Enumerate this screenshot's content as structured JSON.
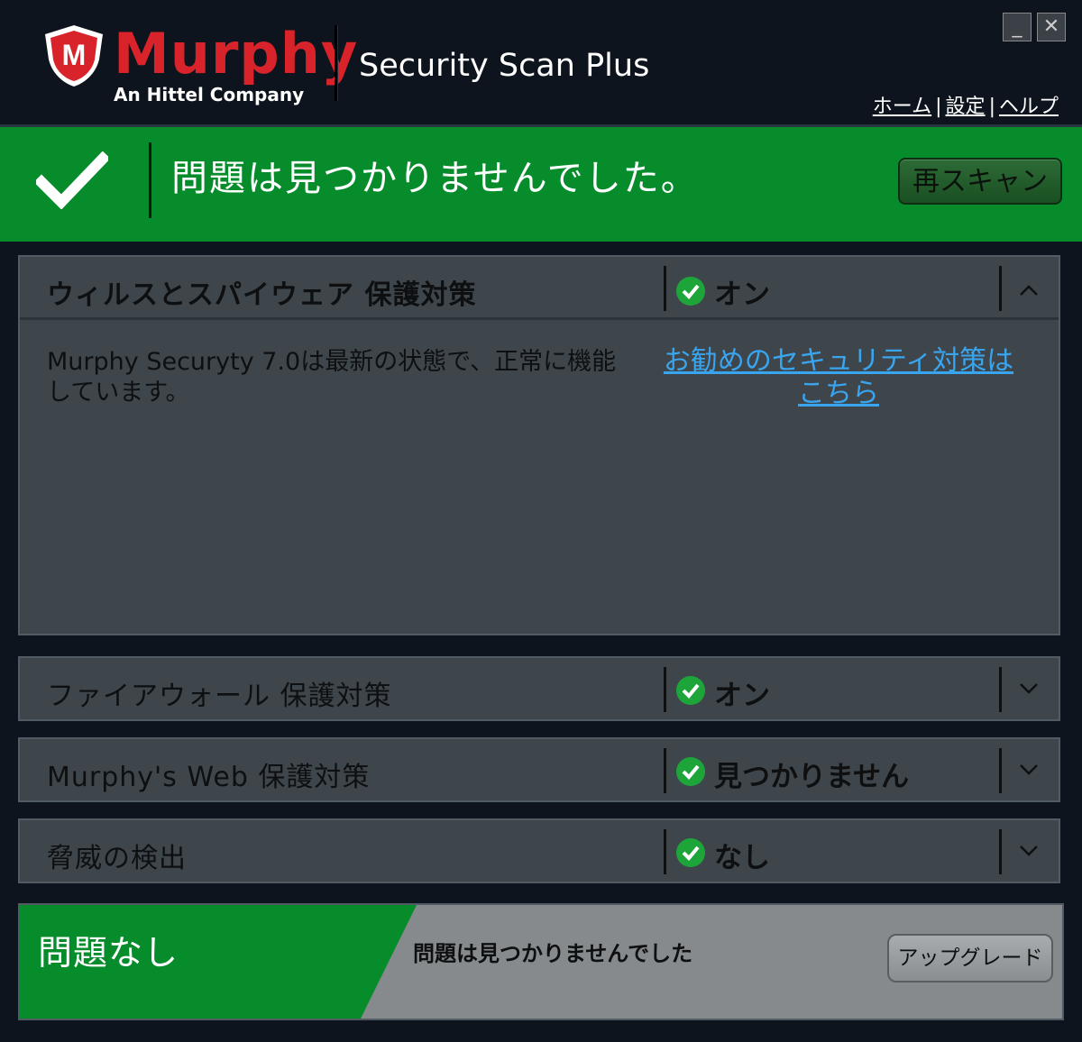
{
  "header": {
    "brand": "Murphy",
    "brand_sub": "An Hittel Company",
    "product": "Security Scan Plus",
    "nav": {
      "home": "ホーム",
      "settings": "設定",
      "help": "ヘルプ",
      "separator": "|"
    },
    "window": {
      "minimize": "_",
      "close": "✕"
    }
  },
  "banner": {
    "message": "問題は見つかりませんでした。",
    "rescan_label": "再スキャン",
    "color": "#078c2c"
  },
  "panels": [
    {
      "title": "ウィルスとスパイウェア 保護対策",
      "status": "オン",
      "expanded": true,
      "body": "Murphy Securyty 7.0は最新の状態で、正常に機能しています。",
      "link": "お勧めのセキュリティ対策はこちら"
    },
    {
      "title": "ファイアウォール 保護対策",
      "status": "オン",
      "expanded": false
    },
    {
      "title": "Murphy's Web 保護対策",
      "status": "見つかりません",
      "expanded": false
    },
    {
      "title": "脅威の検出",
      "status": "なし",
      "expanded": false
    }
  ],
  "footer": {
    "title": "問題なし",
    "message": "問題は見つかりませんでした",
    "upgrade_label": "アップグレード"
  },
  "colors": {
    "accent_green": "#078c2c",
    "brand_red": "#d9232a",
    "link_blue": "#3aa5ef",
    "panel_bg": "#3e464c"
  }
}
